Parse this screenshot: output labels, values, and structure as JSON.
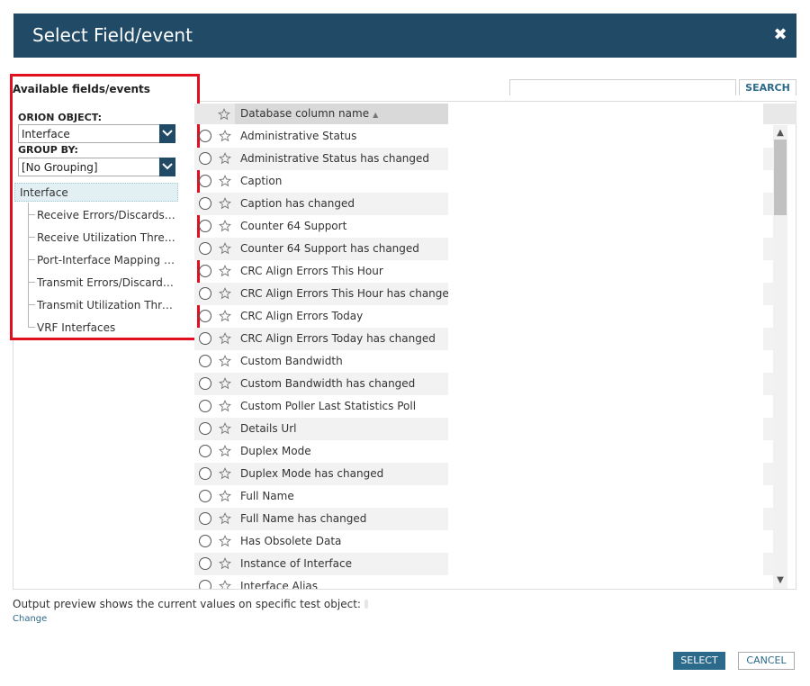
{
  "dialog": {
    "title": "Select Field/event",
    "close_icon": "close-icon"
  },
  "left_panel": {
    "heading": "Available fields/events",
    "orion_object_label": "ORION OBJECT:",
    "orion_object_value": "Interface",
    "group_by_label": "GROUP BY:",
    "group_by_value": "[No Grouping]",
    "tree_root": "Interface",
    "tree_items": [
      "Receive Errors/Discards T...",
      "Receive Utilization Thres...",
      "Port-Interface Mapping o...",
      "Transmit Errors/Discards...",
      "Transmit Utilization Thre...",
      "VRF Interfaces"
    ],
    "highlight_color": "#e01020"
  },
  "search": {
    "value": "",
    "button_label": "SEARCH"
  },
  "grid": {
    "column_header": "Database column name",
    "sort_indicator": "▲",
    "rows": [
      "Administrative Status",
      "Administrative Status has changed",
      "Caption",
      "Caption has changed",
      "Counter 64 Support",
      "Counter 64 Support has changed",
      "CRC Align Errors This Hour",
      "CRC Align Errors This Hour has changed",
      "CRC Align Errors Today",
      "CRC Align Errors Today has changed",
      "Custom Bandwidth",
      "Custom Bandwidth has changed",
      "Custom Poller Last Statistics Poll",
      "Details Url",
      "Duplex Mode",
      "Duplex Mode has changed",
      "Full Name",
      "Full Name has changed",
      "Has Obsolete Data",
      "Instance of Interface",
      "Interface Alias"
    ]
  },
  "footer": {
    "preview_text": "Output preview shows the current values on specific test object:",
    "change_link": "Change",
    "select_button": "SELECT",
    "cancel_button": "CANCEL"
  },
  "colors": {
    "header_bar": "#204a66",
    "accent": "#2b6a8a"
  }
}
